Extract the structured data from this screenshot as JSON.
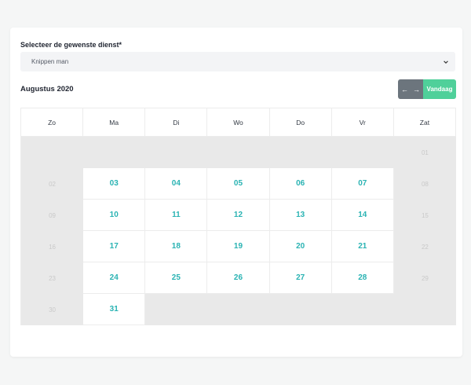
{
  "form": {
    "service_label": "Selecteer de gewenste dienst*",
    "service_value": "Knippen man"
  },
  "calendar": {
    "month_title": "Augustus 2020",
    "nav": {
      "prev": "←",
      "next": "→",
      "today": "Vandaag"
    },
    "weekdays": [
      "Zo",
      "Ma",
      "Di",
      "Wo",
      "Do",
      "Vr",
      "Zat"
    ],
    "weeks": [
      [
        {
          "label": "",
          "state": "empty"
        },
        {
          "label": "",
          "state": "empty"
        },
        {
          "label": "",
          "state": "empty"
        },
        {
          "label": "",
          "state": "empty"
        },
        {
          "label": "",
          "state": "empty"
        },
        {
          "label": "",
          "state": "empty"
        },
        {
          "label": "01",
          "state": "off"
        }
      ],
      [
        {
          "label": "02",
          "state": "off"
        },
        {
          "label": "03",
          "state": "on"
        },
        {
          "label": "04",
          "state": "on"
        },
        {
          "label": "05",
          "state": "on"
        },
        {
          "label": "06",
          "state": "on"
        },
        {
          "label": "07",
          "state": "on"
        },
        {
          "label": "08",
          "state": "off"
        }
      ],
      [
        {
          "label": "09",
          "state": "off"
        },
        {
          "label": "10",
          "state": "on"
        },
        {
          "label": "11",
          "state": "on"
        },
        {
          "label": "12",
          "state": "on"
        },
        {
          "label": "13",
          "state": "on"
        },
        {
          "label": "14",
          "state": "on"
        },
        {
          "label": "15",
          "state": "off"
        }
      ],
      [
        {
          "label": "16",
          "state": "off"
        },
        {
          "label": "17",
          "state": "on"
        },
        {
          "label": "18",
          "state": "on"
        },
        {
          "label": "19",
          "state": "on"
        },
        {
          "label": "20",
          "state": "on"
        },
        {
          "label": "21",
          "state": "on"
        },
        {
          "label": "22",
          "state": "off"
        }
      ],
      [
        {
          "label": "23",
          "state": "off"
        },
        {
          "label": "24",
          "state": "on"
        },
        {
          "label": "25",
          "state": "on"
        },
        {
          "label": "26",
          "state": "on"
        },
        {
          "label": "27",
          "state": "on"
        },
        {
          "label": "28",
          "state": "on"
        },
        {
          "label": "29",
          "state": "off"
        }
      ],
      [
        {
          "label": "30",
          "state": "off"
        },
        {
          "label": "31",
          "state": "on"
        },
        {
          "label": "",
          "state": "empty"
        },
        {
          "label": "",
          "state": "empty"
        },
        {
          "label": "",
          "state": "empty"
        },
        {
          "label": "",
          "state": "empty"
        },
        {
          "label": "",
          "state": "empty"
        }
      ]
    ]
  },
  "colors": {
    "available_day": "#2ab3b3",
    "today_button": "#4fd09a",
    "nav_button": "#6c757d",
    "disabled_cell": "#e9e9e9"
  },
  "icons": {
    "select": "chevron-down-icon",
    "prev": "arrow-left-icon",
    "next": "arrow-right-icon"
  }
}
